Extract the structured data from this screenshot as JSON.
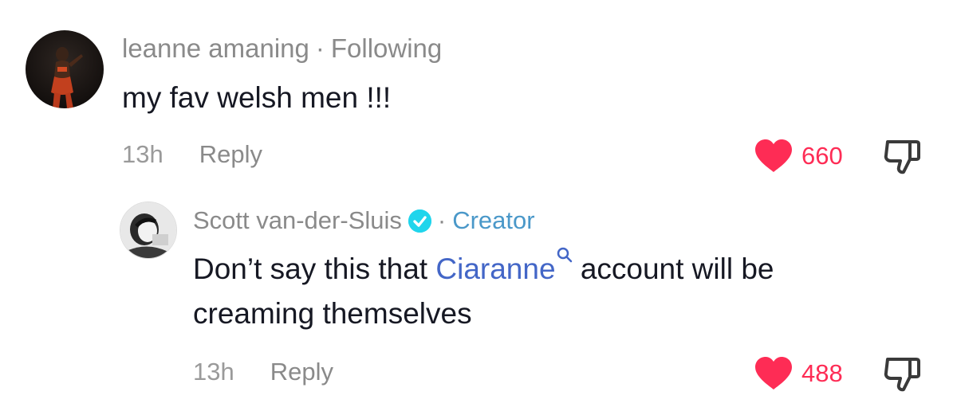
{
  "comments": [
    {
      "username": "leanne amaning",
      "relation": "Following",
      "text": "my fav welsh men !!!",
      "time": "13h",
      "reply_label": "Reply",
      "likes": "660"
    },
    {
      "username": "Scott van-der-Sluis",
      "verified_icon": "verified-badge-icon",
      "relation": "Creator",
      "text_before": "Don’t say this that",
      "mention": "Ciaranne",
      "text_after": "account will be",
      "text_line2": "creaming themselves",
      "time": "13h",
      "reply_label": "Reply",
      "likes": "488"
    }
  ],
  "icons": {
    "like": "heart-icon",
    "dislike": "thumbs-down-icon",
    "search": "search-icon"
  },
  "colors": {
    "like": "#fe2c55",
    "mention": "#4366c7",
    "creator": "#4a98c9",
    "verified": "#20d5ec",
    "meta": "#8a8a8a"
  }
}
